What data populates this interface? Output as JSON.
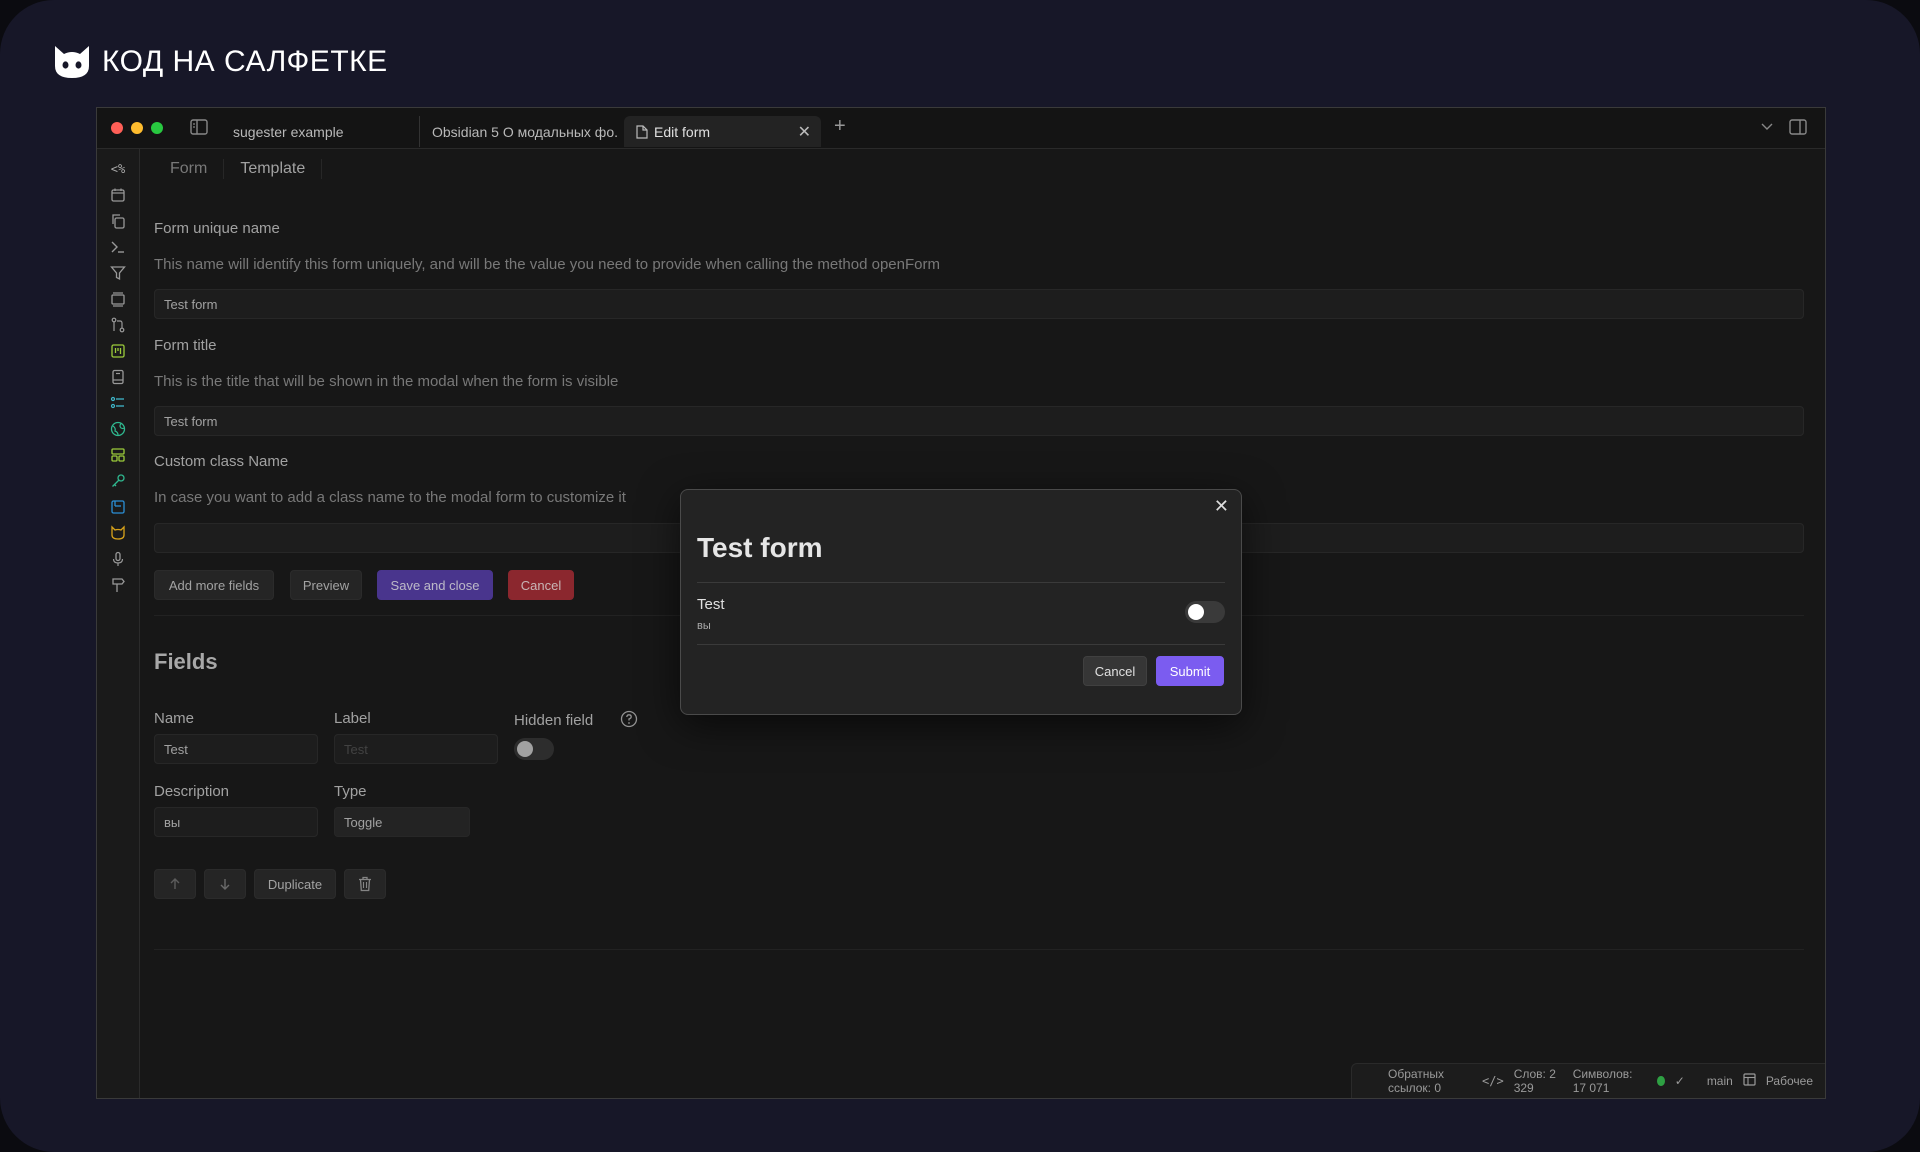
{
  "brand": {
    "title": "КОД НА САЛФЕТКЕ",
    "icon": "cat-logo-icon"
  },
  "tabs": [
    {
      "label": "sugester example",
      "active": false
    },
    {
      "label": "Obsidian 5 О модальных фо...",
      "active": false
    },
    {
      "label": "Edit form",
      "active": true
    }
  ],
  "editor": {
    "subtabs": [
      "Form",
      "Template"
    ],
    "form_unique_name": {
      "label": "Form unique name",
      "description": "This name will identify this form uniquely, and will be the value you need to provide when calling the method openForm",
      "value": "Test form"
    },
    "form_title": {
      "label": "Form title",
      "description": "This is the title that will be shown in the modal when the form is visible",
      "value": "Test form"
    },
    "custom_class": {
      "label": "Custom class Name",
      "description": "In case you want to add a class name to the modal form to customize it",
      "value": ""
    },
    "buttons": {
      "add_more": "Add more fields",
      "preview": "Preview",
      "save_close": "Save and close",
      "cancel": "Cancel"
    },
    "fields": {
      "heading": "Fields",
      "name_label": "Name",
      "name_value": "Test",
      "label_label": "Label",
      "label_placeholder": "Test",
      "hidden_label": "Hidden field",
      "description_label": "Description",
      "description_value": "вы",
      "type_label": "Type",
      "type_value": "Toggle",
      "duplicate": "Duplicate"
    }
  },
  "modal": {
    "title": "Test form",
    "field_label": "Test",
    "field_desc": "вы",
    "cancel": "Cancel",
    "submit": "Submit"
  },
  "status": {
    "backlinks": "Обратных ссылок: 0",
    "words": "Слов: 2 329",
    "chars": "Символов: 17 071",
    "branch": "main",
    "workspace": "Рабочее"
  },
  "colors": {
    "accent": "#7b5cf0",
    "purple_btn": "#5e44b5",
    "danger": "#b3323b",
    "sync_ok": "#2ea043"
  }
}
